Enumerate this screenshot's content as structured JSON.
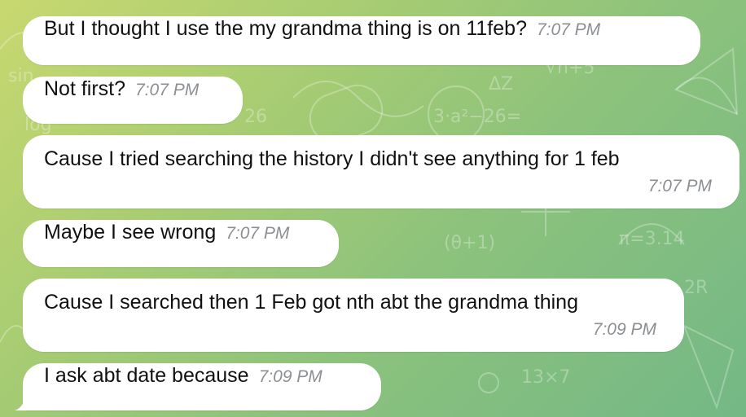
{
  "colors": {
    "bubble": "#ffffff",
    "text": "#111111",
    "timestamp": "#8b8f93",
    "wallpaper_start": "#c8d870",
    "wallpaper_end": "#74b886"
  },
  "messages": [
    {
      "text": "But I thought I use the my grandma thing is on 11feb?",
      "time": "7:07 PM"
    },
    {
      "text": "Not first?",
      "time": "7:07 PM"
    },
    {
      "text": "Cause I tried searching the history I didn't see anything for 1 feb",
      "time": "7:07 PM"
    },
    {
      "text": "Maybe I see wrong",
      "time": "7:07 PM"
    },
    {
      "text": "Cause I searched then 1 Feb got nth abt the grandma thing",
      "time": "7:09 PM"
    },
    {
      "text": "I ask abt date because",
      "time": "7:09 PM"
    }
  ]
}
